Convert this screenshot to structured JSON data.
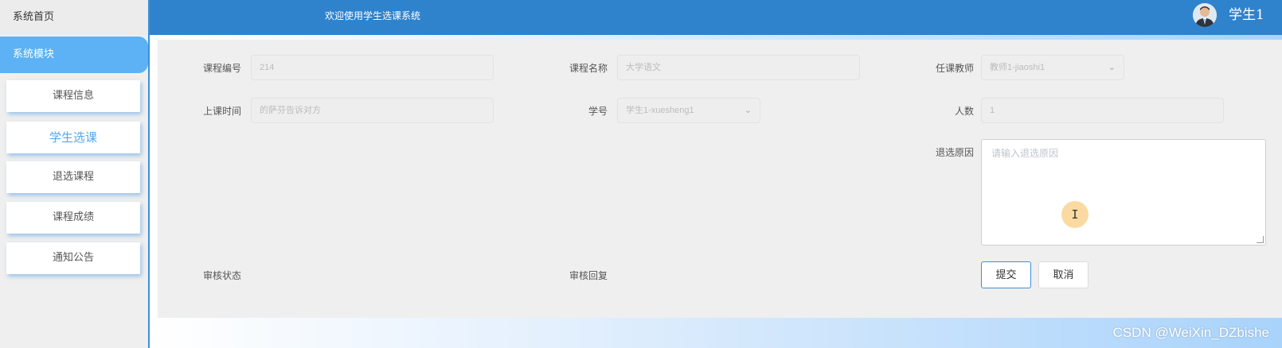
{
  "sidebar": {
    "home_label": "系统首页",
    "module_label": "系统模块",
    "items": [
      {
        "label": "课程信息",
        "active": false
      },
      {
        "label": "学生选课",
        "active": true
      },
      {
        "label": "退选课程",
        "active": false
      },
      {
        "label": "课程成绩",
        "active": false
      },
      {
        "label": "通知公告",
        "active": false
      }
    ]
  },
  "header": {
    "title": "欢迎使用学生选课系统",
    "user_name": "学生1",
    "avatar_icon": "user-avatar-icon"
  },
  "form": {
    "course_no_label": "课程编号",
    "course_no_value": "214",
    "course_name_label": "课程名称",
    "course_name_value": "大学语文",
    "teacher_label": "任课教师",
    "teacher_value": "教师1-jiaoshi1",
    "class_time_label": "上课时间",
    "class_time_value": "的萨芬告诉对方",
    "student_no_label": "学号",
    "student_no_value": "学生1-xuesheng1",
    "count_label": "人数",
    "count_value": "1",
    "reason_label": "退选原因",
    "reason_placeholder": "请输入退选原因",
    "audit_status_label": "审核状态",
    "audit_reply_label": "审核回复",
    "submit_label": "提交",
    "cancel_label": "取消",
    "dropdown_icon": "chevron-down-icon"
  },
  "cursor_glyph": "I",
  "watermark": "CSDN @WeiXin_DZbishe",
  "colors": {
    "header_blue": "#2f83cd",
    "sidebar_active": "#5cb2f4",
    "active_text": "#53a8ee"
  }
}
